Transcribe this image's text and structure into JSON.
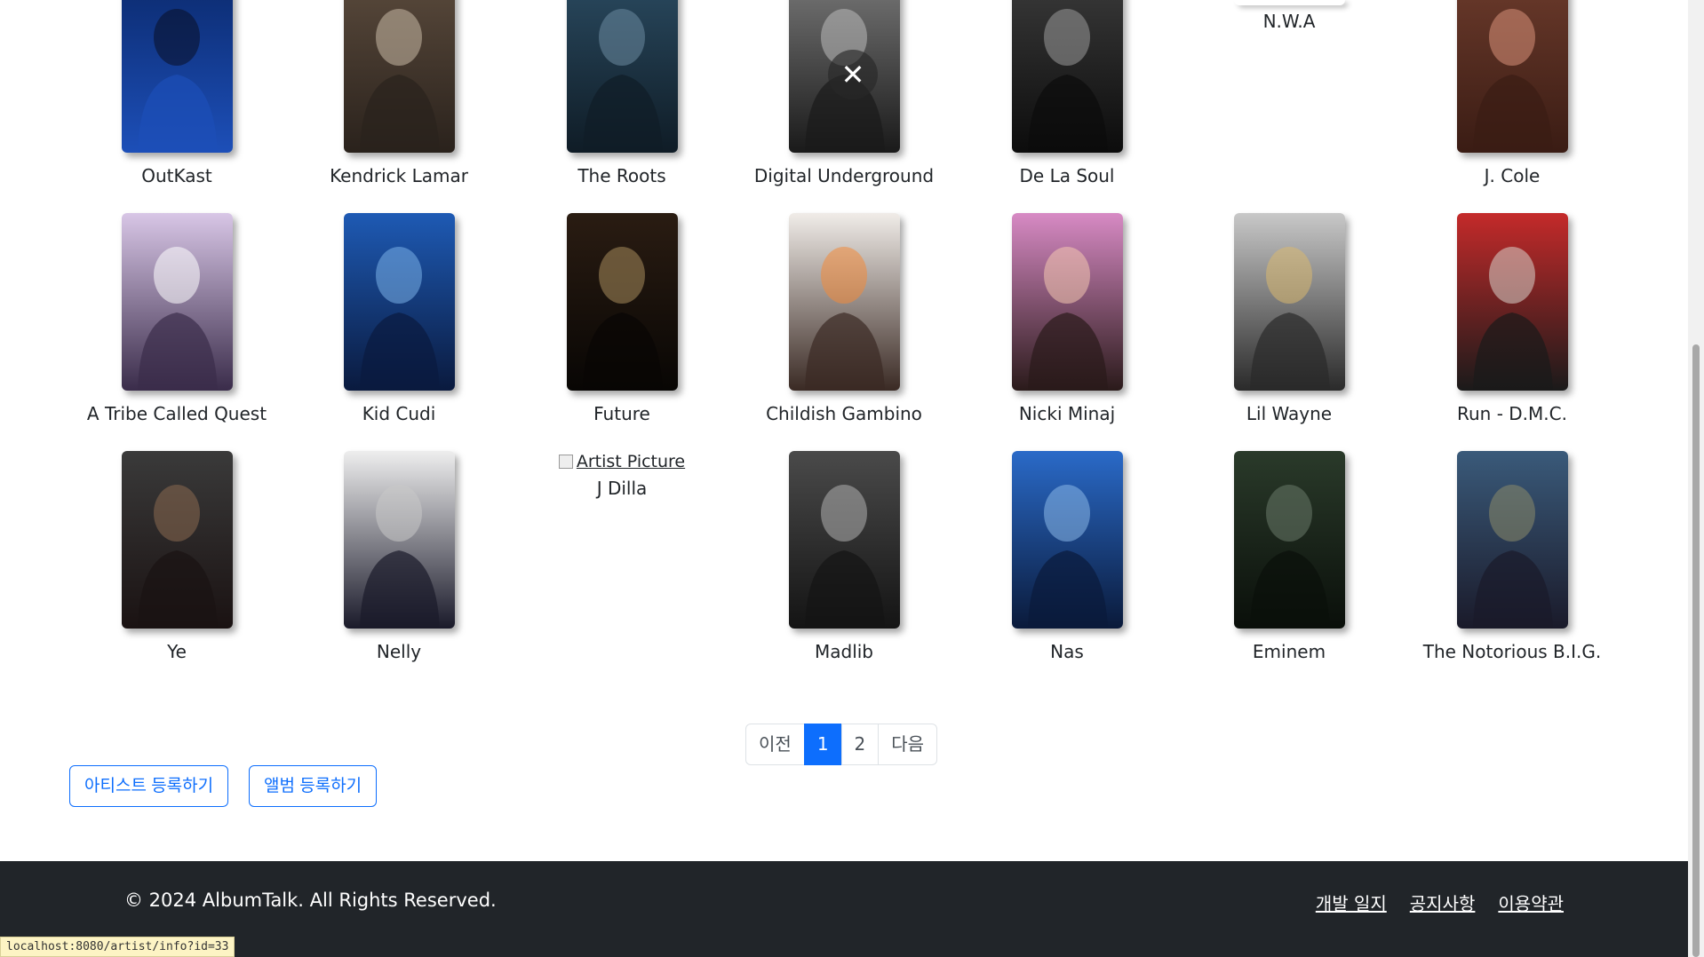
{
  "artists": [
    {
      "name": "OutKast",
      "colors": [
        "#0b2a6e",
        "#1d4fb8",
        "#0a0f24"
      ]
    },
    {
      "name": "Kendrick Lamar",
      "colors": [
        "#5a4a3c",
        "#2a221c",
        "#c8b9a6"
      ]
    },
    {
      "name": "The Roots",
      "colors": [
        "#2a4a60",
        "#0f1c26",
        "#6c8aa0"
      ]
    },
    {
      "name": "Digital Underground",
      "colors": [
        "#777777",
        "#1a1a1a",
        "#bbbbbb"
      ]
    },
    {
      "name": "De La Soul",
      "colors": [
        "#3a3a3a",
        "#0c0c0c",
        "#9a9a9a"
      ]
    },
    {
      "name": "N.W.A",
      "colors": [
        "#ffffff",
        "#ffffff",
        "#ffffff"
      ]
    },
    {
      "name": "J. Cole",
      "colors": [
        "#6b3a2b",
        "#3a1c14",
        "#d9917a"
      ]
    },
    {
      "name": "A Tribe Called Quest",
      "colors": [
        "#d8c6e6",
        "#3a2c4a",
        "#ffffff"
      ]
    },
    {
      "name": "Kid Cudi",
      "colors": [
        "#1e5ab4",
        "#0a1a3e",
        "#7ab0e8"
      ]
    },
    {
      "name": "Future",
      "colors": [
        "#2a1c12",
        "#080604",
        "#a88c5c"
      ]
    },
    {
      "name": "Childish Gambino",
      "colors": [
        "#f0ece8",
        "#3a2a24",
        "#f28a3a"
      ]
    },
    {
      "name": "Nicki Minaj",
      "colors": [
        "#d78ac4",
        "#2a1a1a",
        "#f4c8b0"
      ]
    },
    {
      "name": "Lil Wayne",
      "colors": [
        "#c8c8c8",
        "#2a2a2a",
        "#d8b870"
      ]
    },
    {
      "name": "Run - D.M.C.",
      "colors": [
        "#c42a2a",
        "#1a1a1a",
        "#d8d4cc"
      ]
    },
    {
      "name": "Ye",
      "colors": [
        "#3a3a3a",
        "#1a1212",
        "#8a6a50"
      ]
    },
    {
      "name": "Nelly",
      "colors": [
        "#eeeeee",
        "#1a1a2a",
        "#c8c8c8"
      ]
    },
    {
      "name": "J Dilla",
      "broken": true,
      "alt": "Artist Picture"
    },
    {
      "name": "Madlib",
      "colors": [
        "#4a4a4a",
        "#141414",
        "#b0b0b0"
      ]
    },
    {
      "name": "Nas",
      "colors": [
        "#2a6ac8",
        "#0a1a3a",
        "#8ab8e8"
      ]
    },
    {
      "name": "Eminem",
      "colors": [
        "#2a3a2a",
        "#0a0f0a",
        "#6a7a6a"
      ]
    },
    {
      "name": "The Notorious B.I.G.",
      "colors": [
        "#3a5a7a",
        "#1a1a2a",
        "#8a8a6a"
      ]
    }
  ],
  "pagination": {
    "prev": "이전",
    "pages": [
      "1",
      "2"
    ],
    "active": "1",
    "next": "다음"
  },
  "actions": {
    "register_artist": "아티스트 등록하기",
    "register_album": "앨범 등록하기"
  },
  "footer": {
    "copyright": "© 2024 AlbumTalk. All Rights Reserved.",
    "links": [
      "개발 일지",
      "공지사항",
      "이용약관"
    ]
  },
  "status_bar": {
    "url": "localhost:8080/artist/info?id=33"
  },
  "overlay": {
    "close_glyph": "✕"
  }
}
